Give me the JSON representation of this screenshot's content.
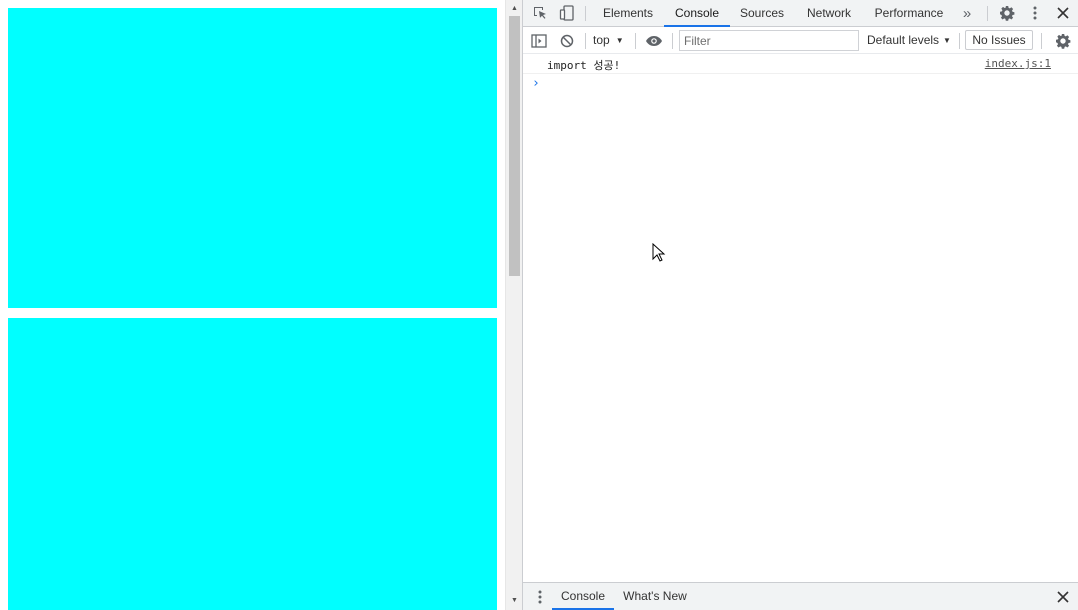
{
  "page": {
    "box_color": "#00ffff"
  },
  "devtools": {
    "tabs": [
      {
        "label": "Elements",
        "active": false
      },
      {
        "label": "Console",
        "active": true
      },
      {
        "label": "Sources",
        "active": false
      },
      {
        "label": "Network",
        "active": false
      },
      {
        "label": "Performance",
        "active": false
      }
    ],
    "toolbar": {
      "context": "top",
      "filter_placeholder": "Filter",
      "filter_value": "",
      "levels": "Default levels",
      "issues": "No Issues"
    },
    "console": {
      "messages": [
        {
          "text": "import 성공!",
          "source": "index.js:1"
        }
      ],
      "prompt": "›"
    },
    "drawer": {
      "tabs": [
        {
          "label": "Console",
          "active": true
        },
        {
          "label": "What's New",
          "active": false
        }
      ]
    }
  },
  "icons": {
    "toolbar": [
      "inspect-icon",
      "device-toolbar-icon",
      "more-tabs-icon",
      "settings-icon",
      "more-options-icon",
      "close-icon"
    ],
    "console_toolbar": [
      "sidebar-toggle-icon",
      "clear-console-icon",
      "live-expression-eye-icon",
      "console-settings-icon"
    ],
    "drawer": [
      "drawer-menu-icon",
      "drawer-close-icon"
    ]
  },
  "colors": {
    "accent": "#1a73e8",
    "cyan": "#00ffff"
  }
}
